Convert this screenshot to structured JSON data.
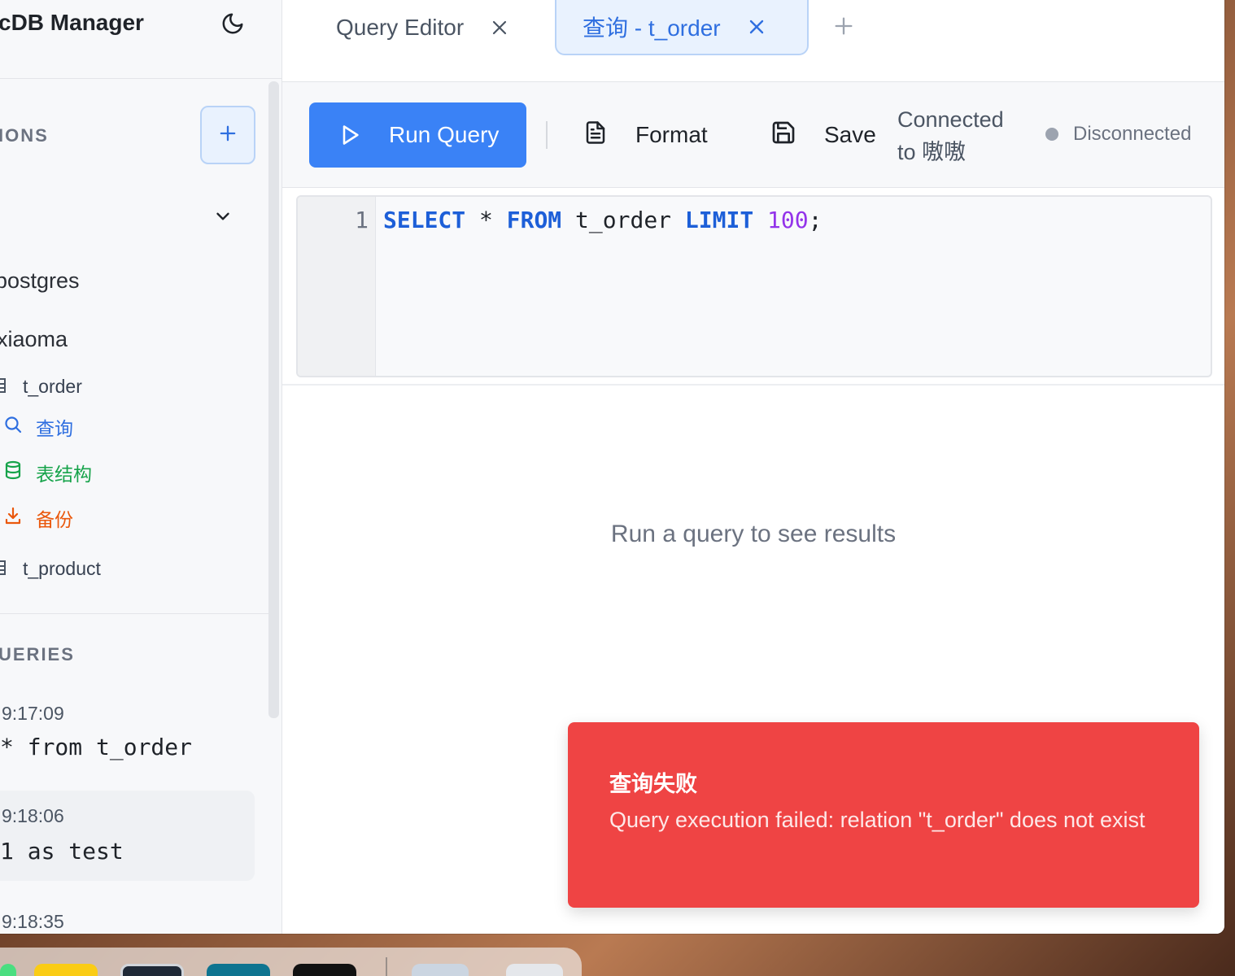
{
  "app": {
    "title": "cDB Manager"
  },
  "sidebar": {
    "connections_section": "IONS",
    "databases": [
      {
        "name": "postgres"
      },
      {
        "name": "xiaoma"
      }
    ],
    "tables": [
      {
        "name": "t_order"
      },
      {
        "name": "t_product"
      }
    ],
    "table_actions": [
      {
        "label": "查询",
        "color": "#2f6fe0"
      },
      {
        "label": "表结构",
        "color": "#16a34a"
      },
      {
        "label": "备份",
        "color": "#ea580c"
      }
    ],
    "queries_section": "UERIES",
    "history": [
      {
        "time": "9:17:09",
        "sql": "* from t_order"
      },
      {
        "time": "9:18:06",
        "sql": "1 as test"
      },
      {
        "time": "9:18:35",
        "sql": ""
      }
    ]
  },
  "tabs": [
    {
      "label": "Query Editor",
      "active": false
    },
    {
      "label": "查询 - t_order",
      "active": true
    }
  ],
  "toolbar": {
    "run_label": "Run Query",
    "format_label": "Format",
    "save_label": "Save",
    "connected_label": "Connected to 嗷嗷",
    "status_label": "Disconnected"
  },
  "editor": {
    "line_number": "1",
    "sql": {
      "select": "SELECT",
      "star": " * ",
      "from": "FROM",
      "table": " t_order ",
      "limit": "LIMIT",
      "value": "100",
      "end": ";"
    }
  },
  "results": {
    "empty_message": "Run a query to see results"
  },
  "toast": {
    "title": "查询失败",
    "message": "Query execution failed: relation \"t_order\" does not exist"
  },
  "colors": {
    "accent": "#3a82f6",
    "error": "#ef4444"
  }
}
